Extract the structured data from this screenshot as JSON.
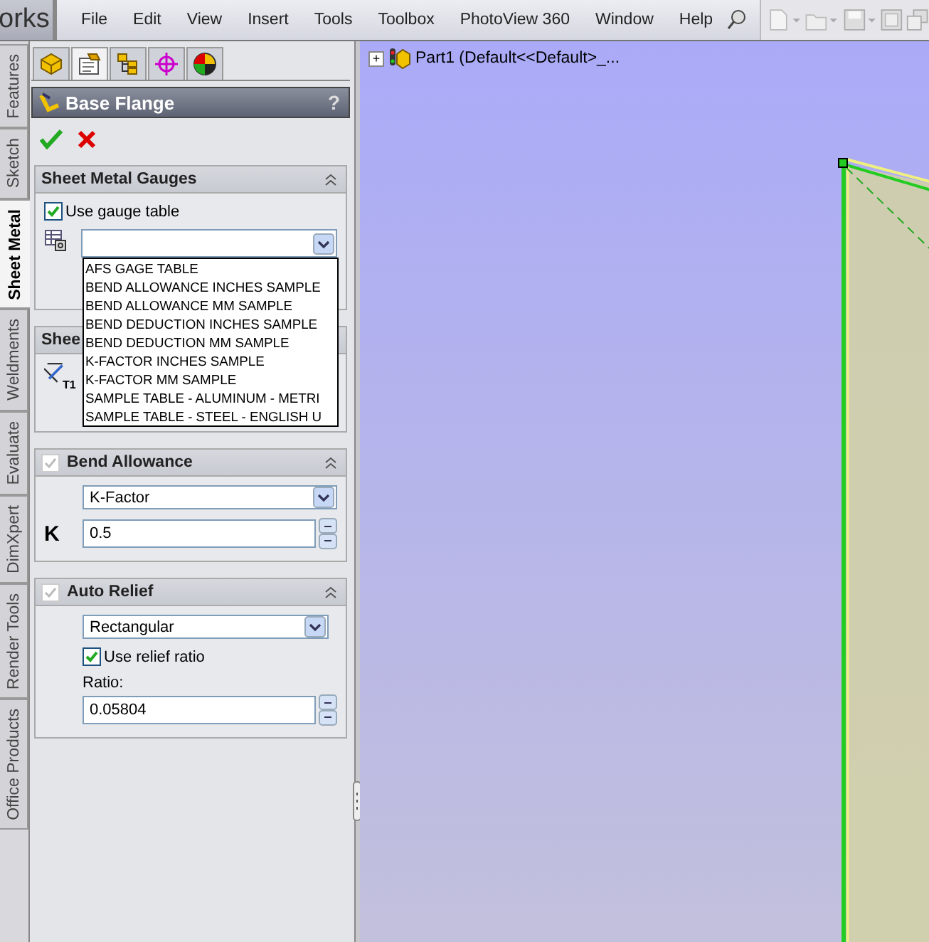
{
  "app_title": "orks",
  "menu": [
    "File",
    "Edit",
    "View",
    "Insert",
    "Tools",
    "Toolbox",
    "PhotoView 360",
    "Window",
    "Help"
  ],
  "side_tabs": [
    {
      "label": "Features",
      "selected": false
    },
    {
      "label": "Sketch",
      "selected": false
    },
    {
      "label": "Sheet Metal",
      "selected": true
    },
    {
      "label": "Weldments",
      "selected": false
    },
    {
      "label": "Evaluate",
      "selected": false
    },
    {
      "label": "DimXpert",
      "selected": false
    },
    {
      "label": "Render Tools",
      "selected": false
    },
    {
      "label": "Office Products",
      "selected": false
    }
  ],
  "panel_tabs": [
    {
      "kind": "feature",
      "selected": false
    },
    {
      "kind": "property",
      "selected": true
    },
    {
      "kind": "config",
      "selected": false
    },
    {
      "kind": "dimxpert",
      "selected": false
    },
    {
      "kind": "display",
      "selected": false
    }
  ],
  "property_manager": {
    "title": "Base Flange",
    "help": "?"
  },
  "gauges": {
    "title": "Sheet Metal Gauges",
    "use_gauge_table": {
      "label": "Use gauge table",
      "checked": true
    },
    "table_select": {
      "expanded": true,
      "options": [
        "AFS GAGE TABLE",
        "BEND ALLOWANCE INCHES SAMPLE",
        "BEND ALLOWANCE MM SAMPLE",
        "BEND DEDUCTION INCHES SAMPLE",
        "BEND DEDUCTION MM SAMPLE",
        "K-FACTOR INCHES SAMPLE",
        "K-FACTOR MM SAMPLE",
        "SAMPLE TABLE - ALUMINUM - METRI",
        "SAMPLE TABLE - STEEL - ENGLISH U"
      ]
    }
  },
  "params": {
    "title": "Shee",
    "thickness_label": "T1"
  },
  "bend_allowance": {
    "title": "Bend Allowance",
    "checked": true,
    "type": "K-Factor",
    "k_label": "K",
    "k_value": "0.5"
  },
  "auto_relief": {
    "title": "Auto Relief",
    "checked": true,
    "type": "Rectangular",
    "use_ratio": {
      "label": "Use relief ratio",
      "checked": true
    },
    "ratio_label": "Ratio:",
    "ratio_value": "0.05804"
  },
  "tree": {
    "expander": "+",
    "label": "Part1  (Default<<Default>_..."
  }
}
